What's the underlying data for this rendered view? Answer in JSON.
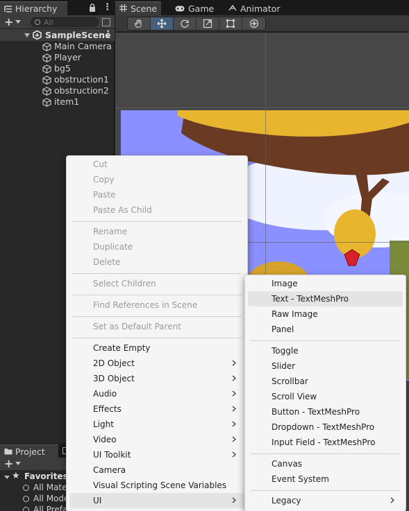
{
  "hierarchy": {
    "tab_label": "Hierarchy",
    "search_placeholder": "All",
    "scene_name": "SampleScene",
    "objects": [
      "Main Camera",
      "Player",
      "bg5",
      "obstruction1",
      "obstruction2",
      "item1"
    ]
  },
  "project": {
    "tab_label": "Project",
    "favorites_label": "Favorites",
    "favorites": [
      "All Mate",
      "All Mode",
      "All Prefa"
    ]
  },
  "scene_tabs": [
    {
      "label": "Scene",
      "icon": "grid-icon"
    },
    {
      "label": "Game",
      "icon": "gamepad-icon"
    },
    {
      "label": "Animator",
      "icon": "animator-icon"
    }
  ],
  "scene_tools": [
    "hand-tool-icon",
    "move-tool-icon",
    "rotate-tool-icon",
    "scale-tool-icon",
    "rect-tool-icon",
    "transform-tool-icon"
  ],
  "context_menu": {
    "items": [
      {
        "label": "Cut",
        "disabled": true
      },
      {
        "label": "Copy",
        "disabled": true
      },
      {
        "label": "Paste",
        "disabled": true
      },
      {
        "label": "Paste As Child",
        "disabled": true
      },
      {
        "label": "Rename",
        "disabled": true
      },
      {
        "label": "Duplicate",
        "disabled": true
      },
      {
        "label": "Delete",
        "disabled": true
      },
      {
        "label": "Select Children",
        "disabled": true
      },
      {
        "label": "Find References in Scene",
        "disabled": true
      },
      {
        "label": "Set as Default Parent",
        "disabled": true
      },
      {
        "label": "Create Empty",
        "disabled": false
      },
      {
        "label": "2D Object",
        "disabled": false,
        "submenu": true
      },
      {
        "label": "3D Object",
        "disabled": false,
        "submenu": true
      },
      {
        "label": "Audio",
        "disabled": false,
        "submenu": true
      },
      {
        "label": "Effects",
        "disabled": false,
        "submenu": true
      },
      {
        "label": "Light",
        "disabled": false,
        "submenu": true
      },
      {
        "label": "Video",
        "disabled": false,
        "submenu": true
      },
      {
        "label": "UI Toolkit",
        "disabled": false,
        "submenu": true
      },
      {
        "label": "Camera",
        "disabled": false
      },
      {
        "label": "Visual Scripting Scene Variables",
        "disabled": false
      },
      {
        "label": "UI",
        "disabled": false,
        "submenu": true,
        "highlighted": true
      }
    ]
  },
  "ui_submenu": {
    "items": [
      {
        "label": "Image"
      },
      {
        "label": "Text - TextMeshPro",
        "highlighted": true
      },
      {
        "label": "Raw Image"
      },
      {
        "label": "Panel"
      },
      {
        "label": "Toggle"
      },
      {
        "label": "Slider"
      },
      {
        "label": "Scrollbar"
      },
      {
        "label": "Scroll View"
      },
      {
        "label": "Button - TextMeshPro"
      },
      {
        "label": "Dropdown - TextMeshPro"
      },
      {
        "label": "Input Field - TextMeshPro"
      },
      {
        "label": "Canvas"
      },
      {
        "label": "Event System"
      },
      {
        "label": "Legacy",
        "submenu": true
      }
    ]
  },
  "colors": {
    "editor_bg": "#282828",
    "menu_bg": "#f5f5f5",
    "tool_active": "#46607c",
    "sky": "#8a90ff",
    "tree_foliage": "#e8b52e",
    "trunk": "#6b3a22",
    "gem": "#d81f2a"
  }
}
